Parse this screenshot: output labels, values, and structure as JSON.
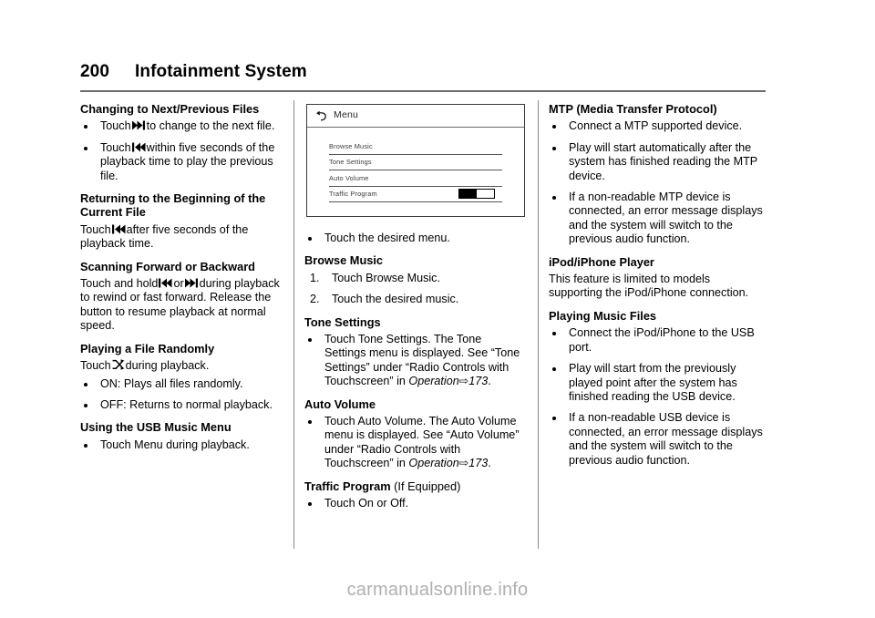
{
  "header": {
    "page_number": "200",
    "title": "Infotainment System"
  },
  "left_column": {
    "heading_1": "Changing to Next/Previous Files",
    "bullet_1a": "Touch",
    "bullet_1a_cont": "to change to the next file.",
    "bullet_1b": "Touch",
    "bullet_1b_cont": "within five seconds of the playback time to play the previous file.",
    "heading_2": "Returning to the Beginning of the Current File",
    "para_2_pre": "Touch",
    "para_2_post": "after five seconds of the playback time.",
    "heading_3": "Scanning Forward or Backward",
    "para_3_pre": "Touch and hold",
    "para_3_mid": "or",
    "para_3_post": "during playback to rewind or fast forward. Release the button to resume playback at normal speed.",
    "heading_4": "Playing a File Randomly",
    "para_4_pre": "Touch",
    "para_4_post": "during playback.",
    "bullet_4a": "ON: Plays all files randomly.",
    "bullet_4b": "OFF: Returns to normal playback.",
    "heading_5": "Using the USB Music Menu",
    "bullet_5a": "Touch Menu during playback."
  },
  "figure": {
    "screen_title": "Menu",
    "back_icon": "back-arrow-icon",
    "rows": [
      {
        "label": "Browse Music",
        "control": "none"
      },
      {
        "label": "Tone Settings",
        "control": "none"
      },
      {
        "label": "Auto Volume",
        "control": "none"
      },
      {
        "label": "Traffic Program",
        "control": "toggle",
        "toggle_state": "on"
      }
    ]
  },
  "middle_column": {
    "bullet_0": "Touch the desired menu.",
    "heading_browse": "Browse Music",
    "step_1": "Touch Browse Music.",
    "step_2": "Touch the desired music.",
    "heading_tone": "Tone Settings",
    "bullet_tone": "Touch Tone Settings. The Tone Settings menu is displayed. See “Tone Settings” under “Radio Controls with Touchscreen” in",
    "xref_tone_title": "Operation",
    "xref_arrow": "⇨",
    "xref_tone_page": "173",
    "heading_auto": "Auto Volume",
    "bullet_auto": "Touch Auto Volume. The Auto Volume menu is displayed. See “Auto Volume” under “Radio Controls with Touchscreen” in",
    "xref_auto_title": "Operation",
    "xref_auto_page": "173",
    "heading_traffic": "Traffic Program",
    "heading_traffic_note": "(If Equipped)",
    "bullet_traffic": "Touch On or Off."
  },
  "right_column": {
    "heading_mtp": "MTP (Media Transfer Protocol)",
    "bullet_mtp_1": "Connect a MTP supported device.",
    "bullet_mtp_2": "Play will start automatically after the system has finished reading the MTP device.",
    "bullet_mtp_3": "If a non-readable MTP device is connected, an error message displays and the system will switch to the previous audio function.",
    "heading_ipod": "iPod/iPhone Player",
    "para_ipod": "This feature is limited to models supporting the iPod/iPhone connection.",
    "heading_playing": "Playing Music Files",
    "bullet_play_1": "Connect the iPod/iPhone to the USB port.",
    "bullet_play_2": "Play will start from the previously played point after the system has finished reading the USB device.",
    "bullet_play_3": "If a non-readable USB device is connected, an error message displays and the system will switch to the previous audio function."
  },
  "watermark": {
    "text": "carmanualsonline.info"
  },
  "colors": {
    "text": "#000000",
    "rule": "#6b6b6b",
    "divider": "#8a8a8a",
    "watermark": "#b0b0b0",
    "screen_border": "#3a3a3a"
  }
}
